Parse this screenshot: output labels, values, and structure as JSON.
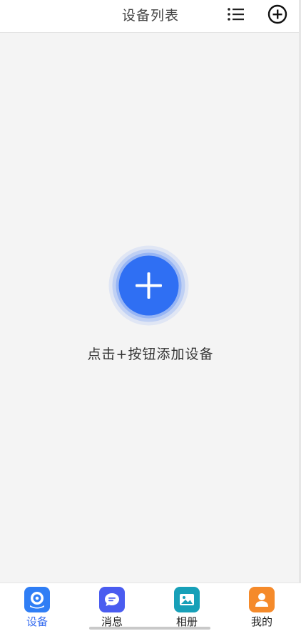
{
  "header": {
    "title": "设备列表",
    "list_icon": "list-icon",
    "add_icon": "plus-circle-icon"
  },
  "empty_state": {
    "add_icon": "plus-icon",
    "text": "点击+按钮添加设备"
  },
  "tabs": [
    {
      "label": "设备",
      "icon": "camera-icon",
      "color": "#2f7ef5",
      "active": true
    },
    {
      "label": "消息",
      "icon": "message-icon",
      "color": "#4a5cf0",
      "active": false
    },
    {
      "label": "相册",
      "icon": "photo-icon",
      "color": "#17a0b8",
      "active": false
    },
    {
      "label": "我的",
      "icon": "person-icon",
      "color": "#f58a2a",
      "active": false
    }
  ],
  "colors": {
    "accent": "#3a6ff0",
    "add_button": "#2f6ff3"
  }
}
